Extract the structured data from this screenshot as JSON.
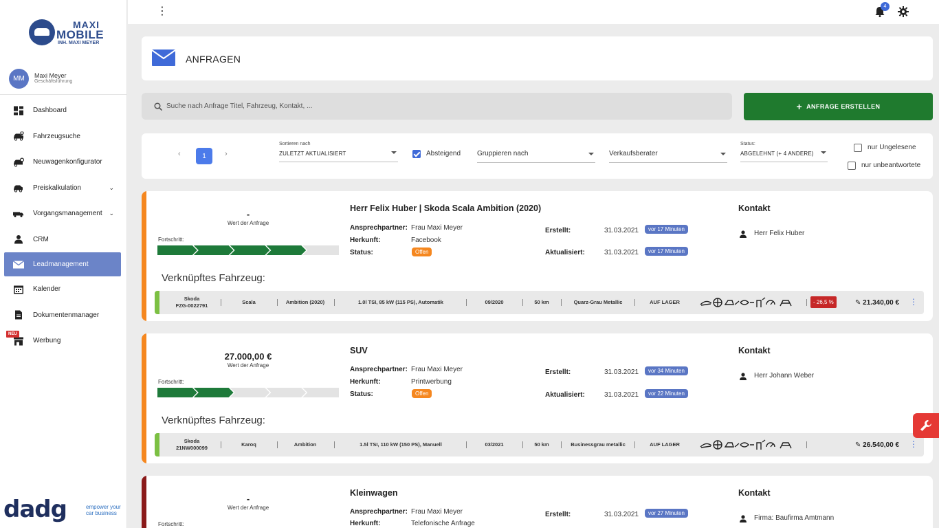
{
  "brand": {
    "logo_top": "MAXI",
    "logo_main": "MOBILE",
    "logo_sub": "INH. MAXI MEYER"
  },
  "user": {
    "initials": "MM",
    "name": "Maxi Meyer",
    "role": "Geschäftsführung"
  },
  "nav": [
    {
      "label": "Dashboard",
      "icon": "dashboard-icon"
    },
    {
      "label": "Fahrzeugsuche",
      "icon": "car-search-icon"
    },
    {
      "label": "Neuwagenkonfigurator",
      "icon": "car-config-icon"
    },
    {
      "label": "Preiskalkulation",
      "icon": "car-price-icon",
      "expandable": true
    },
    {
      "label": "Vorgangsmanagement",
      "icon": "truck-icon",
      "expandable": true
    },
    {
      "label": "CRM",
      "icon": "person-icon"
    },
    {
      "label": "Leadmanagement",
      "icon": "mail-icon",
      "active": true
    },
    {
      "label": "Kalender",
      "icon": "calendar-icon"
    },
    {
      "label": "Dokumentenmanager",
      "icon": "document-icon"
    },
    {
      "label": "Werbung",
      "icon": "store-icon",
      "badge": "NEU"
    }
  ],
  "footer": {
    "word": "dadg",
    "tagline": "empower your car business"
  },
  "topbar": {
    "notifications": "4"
  },
  "header": {
    "title": "ANFRAGEN"
  },
  "search": {
    "placeholder": "Suche nach Anfrage Titel, Fahrzeug, Kontakt, ..."
  },
  "create_button": "ANFRAGE ERSTELLEN",
  "filters": {
    "page": "1",
    "sort_label": "Sortieren nach",
    "sort_value": "ZULETZT AKTUALISIERT",
    "descending_label": "Absteigend",
    "descending_checked": true,
    "group_placeholder": "Gruppieren nach",
    "advisor_placeholder": "Verkaufsberater",
    "status_label": "Status:",
    "status_value": "ABGELEHNT  (+ 4 ANDERE)",
    "unread_label": "nur Ungelesene",
    "unanswered_label": "nur unbeantwortete"
  },
  "labels": {
    "value_caption": "Wert der Anfrage",
    "progress": "Fortschritt:",
    "contact_person": "Ansprechpartner:",
    "origin": "Herkunft:",
    "status": "Status:",
    "created": "Erstellt:",
    "updated": "Aktualisiert:",
    "contact": "Kontakt",
    "linked_vehicle": "Verknüpftes Fahrzeug:"
  },
  "inquiries": [
    {
      "value": "-",
      "progress_steps": 4,
      "title": "Herr Felix Huber | Skoda Scala Ambition (2020)",
      "contact_person": "Frau Maxi Meyer",
      "origin": "Facebook",
      "status": "Offen",
      "created": "31.03.2021",
      "created_ago": "vor 17 Minuten",
      "updated": "31.03.2021",
      "updated_ago": "vor 17 Minuten",
      "contact": "Herr Felix Huber",
      "vehicle": {
        "make": "Skoda",
        "id": "FZG-0022791",
        "model": "Scala",
        "trim": "Ambition (2020)",
        "engine": "1.0l TSI, 85 kW (115 PS), Automatik",
        "date": "09/2020",
        "km": "50 km",
        "color": "Quarz-Grau Metallic",
        "stock": "AUF LAGER",
        "discount": "- 26,5 %",
        "price": "21.340,00 €"
      }
    },
    {
      "value": "27.000,00 €",
      "progress_steps": 2,
      "title": "SUV",
      "contact_person": "Frau Maxi Meyer",
      "origin": "Printwerbung",
      "status": "Offen",
      "created": "31.03.2021",
      "created_ago": "vor 34 Minuten",
      "updated": "31.03.2021",
      "updated_ago": "vor 22 Minuten",
      "contact": "Herr Johann Weber",
      "vehicle": {
        "make": "Skoda",
        "id": "21NW000099",
        "model": "Karoq",
        "trim": "Ambition",
        "engine": "1.5l TSI, 110 kW (150 PS), Manuell",
        "date": "03/2021",
        "km": "50 km",
        "color": "Businessgrau metallic",
        "stock": "AUF LAGER",
        "discount": "",
        "price": "26.540,00 €"
      }
    },
    {
      "value": "-",
      "title": "Kleinwagen",
      "contact_person": "Frau Maxi Meyer",
      "origin": "Telefonische Anfrage",
      "created": "31.03.2021",
      "created_ago": "vor 27 Minuten",
      "contact": "Firma: Baufirma Amtmann"
    }
  ],
  "colors": {
    "accent": "#3f6ad8",
    "create_button": "#1f7a2e",
    "progress_done": "#1e7a3a",
    "open_status": "#f5871f",
    "sidebar_active": "#6b84c8"
  }
}
